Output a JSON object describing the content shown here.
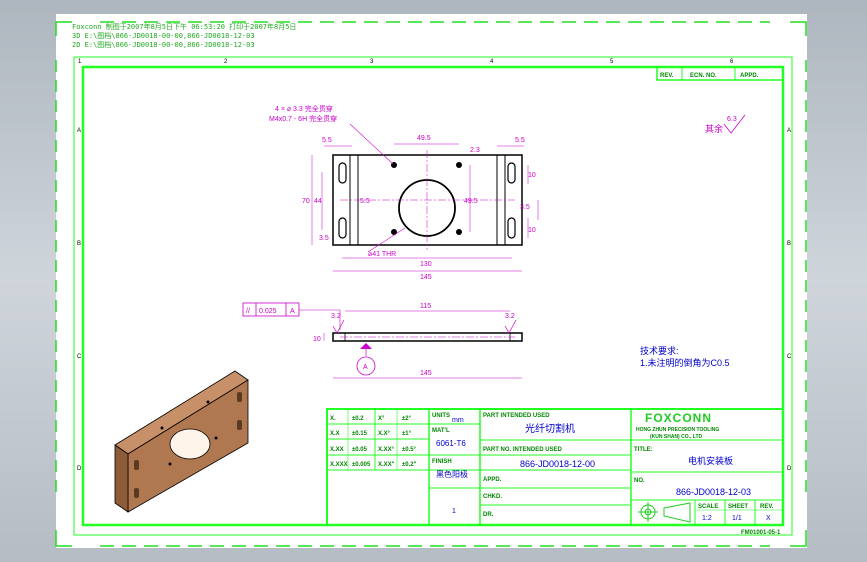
{
  "header": {
    "line1": "Foxconn  制图于2007年8月5日下午 06:53:20  打印于2007年8月5日",
    "line2": "3D   E:\\图档\\866-JD0018-00-00,866-JD0018-12-03",
    "line3": "2D   E:\\图档\\866-JD0018-00-00,866-JD0018-12-03"
  },
  "zones": {
    "top": [
      "1",
      "2",
      "3",
      "4",
      "5",
      "6"
    ],
    "side": [
      "A",
      "B",
      "C",
      "D"
    ]
  },
  "revision_table": {
    "rev": "REV.",
    "ecn": "ECN. NO.",
    "approved": "APPD."
  },
  "roughness": {
    "symbol": "其余",
    "value": "6.3"
  },
  "callouts": {
    "holes1": "4 × ⌀ 3.3 完全贯穿",
    "holes2": "M4x0.7 - 6H 完全贯穿",
    "bore": "⌀41 THR"
  },
  "dims": {
    "top_left": "5.5",
    "top_mid": "49.5",
    "top_right": "5.5",
    "right_small": "2.3",
    "height_total": "70",
    "height_inner": "44",
    "height_mid": "5.5",
    "left_bottom": "3.5",
    "right_mid": "49.5",
    "slot_top": "10",
    "slot_bottom": "10",
    "right_bot": "3.5",
    "width_inner": "130",
    "width_total": "145",
    "side_top": "115",
    "side_width": "145",
    "thickness": "10",
    "rough_left": "3.2",
    "rough_right": "3.2"
  },
  "tolerance_frame": {
    "symbol": "//",
    "value": "0.025",
    "datum": "A"
  },
  "datum_label": "A",
  "notes": {
    "title": "技术要求:",
    "item1": "1.未注明的倒角为C0.5"
  },
  "title_block": {
    "tol_rows": [
      [
        "X.",
        "±0.2",
        "X°",
        "±2°"
      ],
      [
        "X.X",
        "±0.15",
        "X.X°",
        "±1°"
      ],
      [
        "X.XX",
        "±0.05",
        "X.XX°",
        "±0.5°"
      ],
      [
        "X.XXX",
        "±0.005",
        "X.XX\"",
        "±0.2\""
      ]
    ],
    "units_label": "UNITS",
    "units_value": "mm",
    "material_label": "MAT'L",
    "material_value": "6061-T6",
    "finish_label": "FINISH",
    "finish_value": "黑色阳极",
    "qty_value": "1",
    "used_on_label": "PART INTENDED USED",
    "used_on_value": "光纤切割机",
    "part_no_label": "PART NO. INTENDED USED",
    "part_no_value": "866-JD0018-12-00",
    "appd_label": "APPD.",
    "chkd_label": "CHKD.",
    "dr_label": "DR.",
    "company": "FOXCONN",
    "company_sub1": "HONG ZHUN PRECISION TOOLING",
    "company_sub2": "(KUN SHAN) CO., LTD",
    "title_label": "TITLE:",
    "title_value": "电机安装板",
    "drawing_no_label": "NO.",
    "drawing_no": "866-JD0018-12-03",
    "scale_label": "SCALE",
    "scale_value": "1:2",
    "sheet_label": "SHEET",
    "sheet_value": "1/1",
    "rev_label": "REV.",
    "rev_value": "X",
    "form_no": "FM01001-05-1"
  },
  "colors": {
    "frame": "#22ff22",
    "magenta": "#cc00cc",
    "blue": "#0000cc",
    "part": "#b07850"
  }
}
